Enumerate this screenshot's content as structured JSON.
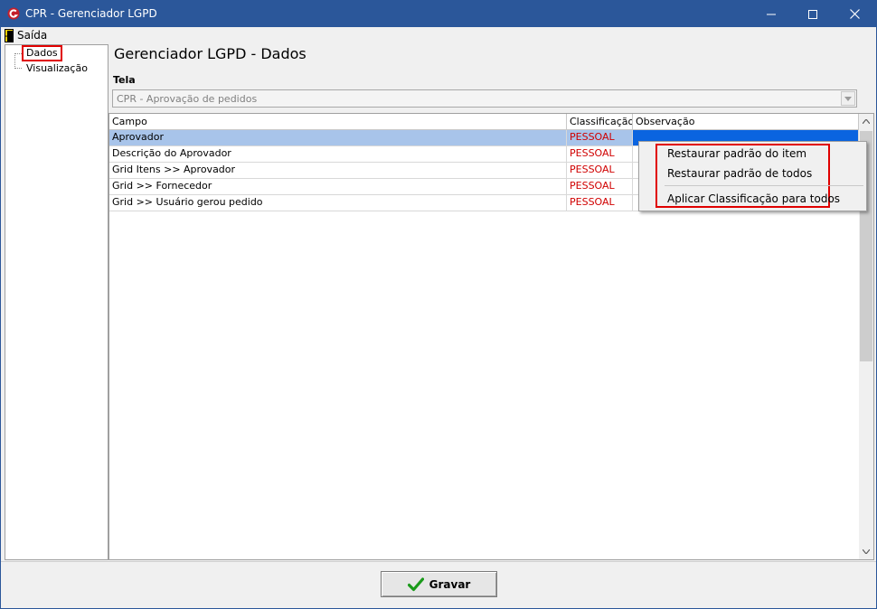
{
  "window": {
    "title": "CPR - Gerenciador LGPD",
    "controls": {
      "minimize": "—",
      "maximize": "☐",
      "close": "✕"
    }
  },
  "menubar": {
    "exit_label": "Saída",
    "exit_icon": "door-exit-icon"
  },
  "tree": {
    "items": [
      {
        "label": "Dados",
        "selected": true
      },
      {
        "label": "Visualização",
        "selected": false
      }
    ]
  },
  "main": {
    "title": "Gerenciador LGPD - Dados",
    "tela_label": "Tela",
    "tela_value": "CPR - Aprovação de pedidos"
  },
  "grid": {
    "columns": [
      "Campo",
      "Classificação",
      "Observação"
    ],
    "rows": [
      {
        "campo": "Aprovador",
        "classificacao": "PESSOAL",
        "observacao": "",
        "selected": true
      },
      {
        "campo": "Descrição do Aprovador",
        "classificacao": "PESSOAL",
        "observacao": "",
        "selected": false
      },
      {
        "campo": "Grid  Itens >> Aprovador",
        "classificacao": "PESSOAL",
        "observacao": "",
        "selected": false
      },
      {
        "campo": "Grid >> Fornecedor",
        "classificacao": "PESSOAL",
        "observacao": "",
        "selected": false
      },
      {
        "campo": "Grid >> Usuário gerou pedido",
        "classificacao": "PESSOAL",
        "observacao": "",
        "selected": false
      }
    ]
  },
  "context_menu": {
    "items": [
      "Restaurar padrão do item",
      "Restaurar padrão de todos",
      "Aplicar Classificação para todos"
    ]
  },
  "footer": {
    "save_label": "Gravar",
    "save_icon": "checkmark-icon"
  },
  "colors": {
    "titlebar": "#2b579a",
    "highlight_box": "#e00000",
    "classification_text": "#d00000",
    "selected_row": "#a8c4ea",
    "selected_cell": "#0a64e0",
    "check": "#1a9a1a"
  }
}
